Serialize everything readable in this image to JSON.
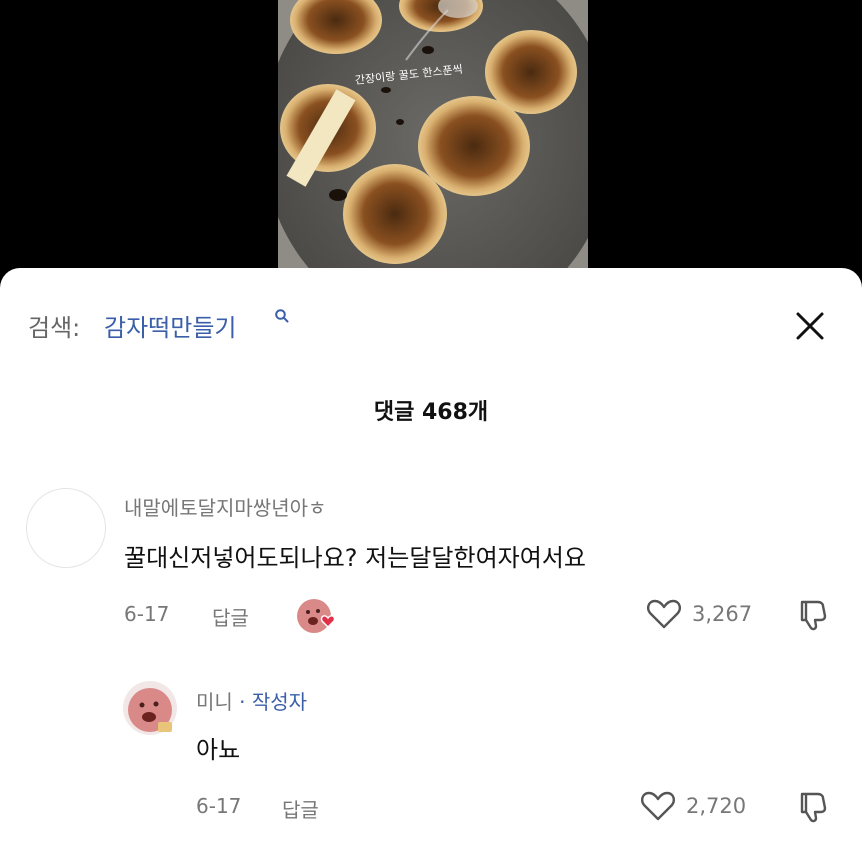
{
  "video": {
    "caption": "간장이랑 꿀도 한스푼씩"
  },
  "search": {
    "label": "검색:",
    "term": "감자떡만들기"
  },
  "comments_header": {
    "count_label": "댓글 468개"
  },
  "comments": [
    {
      "username": "내말에토달지마쌍년아ㅎ",
      "text": "꿀대신저넣어도되나요? 저는달달한여자여서요",
      "date": "6-17",
      "reply_label": "답글",
      "likes": "3,267"
    }
  ],
  "replies": [
    {
      "username": "미니",
      "badge": "· 작성자",
      "text": "아뇨",
      "date": "6-17",
      "reply_label": "답글",
      "likes": "2,720"
    }
  ],
  "colors": {
    "accent": "#3a5fa8",
    "muted": "#777777",
    "heart": "#e0304a"
  }
}
